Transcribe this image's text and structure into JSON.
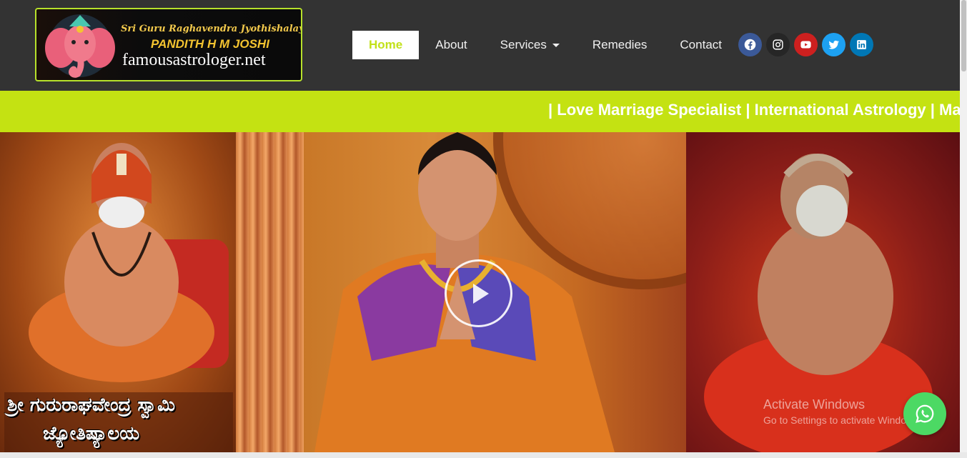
{
  "brand": {
    "line1": "Sri Guru Raghavendra Jyothishalaya",
    "line2": "PANDITH H M JOSHI",
    "line3": "famousastrologer.net"
  },
  "nav": {
    "items": [
      {
        "label": "Home",
        "active": true
      },
      {
        "label": "About"
      },
      {
        "label": "Services",
        "dropdown": true
      },
      {
        "label": "Remedies"
      },
      {
        "label": "Contact"
      }
    ]
  },
  "socials": [
    {
      "icon": "facebook-icon",
      "color": "#3b5998"
    },
    {
      "icon": "instagram-icon",
      "color": "#262626"
    },
    {
      "icon": "youtube-icon",
      "color": "#cd201f"
    },
    {
      "icon": "twitter-icon",
      "color": "#1da1f2"
    },
    {
      "icon": "linkedin-icon",
      "color": "#0077b5"
    }
  ],
  "ticker": {
    "text": "| Love Marriage Specialist | International Astrology | Marriage"
  },
  "hero": {
    "kannada_line1": "ಶ್ರೀ ಗುರುರಾಘವೇಂದ್ರ ಸ್ವಾಮಿ",
    "kannada_line2": "ಜ್ಯೋತಿಷ್ಯಾಲಯ"
  },
  "overlay": {
    "activate_title": "Activate Windows",
    "activate_sub": "Go to Settings to activate Windows."
  },
  "colors": {
    "header_bg": "#333333",
    "accent": "#c4e212",
    "whatsapp": "#4cd964"
  }
}
